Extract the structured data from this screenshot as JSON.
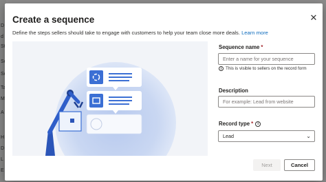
{
  "background": {
    "letters": [
      "D",
      "d",
      "St",
      "Se",
      "Se",
      "Ta",
      "M",
      "A",
      "H",
      "D",
      "L",
      "E"
    ]
  },
  "dialog": {
    "title": "Create a sequence",
    "close_label": "✕",
    "description": "Define the steps sellers should take to engage with customers to help your team close more deals.",
    "learn_more": "Learn more"
  },
  "form": {
    "sequence_name": {
      "label": "Sequence name",
      "required_mark": "*",
      "placeholder": "Enter a name for your sequence",
      "hint": "This is visible to sellers on the record form",
      "hint_icon": "i"
    },
    "description": {
      "label": "Description",
      "placeholder": "For example: Lead from website"
    },
    "record_type": {
      "label": "Record type",
      "required_mark": "*",
      "info_icon": "i",
      "value": "Lead",
      "chevron": "⌄"
    }
  },
  "buttons": {
    "next": "Next",
    "cancel": "Cancel"
  },
  "colors": {
    "accent": "#0f6cbd",
    "illustration_blue": "#3b6fd4",
    "required": "#a4262c"
  }
}
